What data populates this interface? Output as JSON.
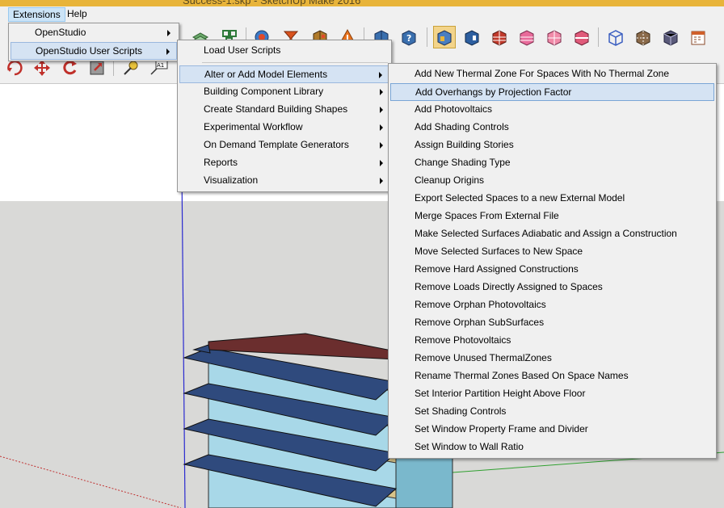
{
  "window": {
    "title": "Success-1.skp - SketchUp Make 2016"
  },
  "menubar": {
    "items": [
      {
        "label": "Extensions"
      },
      {
        "label": "Help"
      }
    ]
  },
  "extensions_menu": {
    "items": [
      {
        "label": "OpenStudio"
      },
      {
        "label": "OpenStudio User Scripts"
      }
    ]
  },
  "user_scripts_menu": {
    "items": [
      {
        "label": "Load User Scripts"
      },
      {
        "label": "Alter or Add Model Elements"
      },
      {
        "label": "Building Component Library"
      },
      {
        "label": "Create Standard Building Shapes"
      },
      {
        "label": "Experimental Workflow"
      },
      {
        "label": "On Demand Template Generators"
      },
      {
        "label": "Reports"
      },
      {
        "label": "Visualization"
      }
    ]
  },
  "alter_menu": {
    "items": [
      {
        "label": "Add New Thermal Zone For Spaces With No Thermal Zone"
      },
      {
        "label": "Add Overhangs by Projection Factor"
      },
      {
        "label": "Add Photovoltaics"
      },
      {
        "label": "Add Shading Controls"
      },
      {
        "label": "Assign Building Stories"
      },
      {
        "label": "Change Shading Type"
      },
      {
        "label": "Cleanup Origins"
      },
      {
        "label": "Export Selected Spaces to a new External Model"
      },
      {
        "label": "Merge Spaces From External File"
      },
      {
        "label": "Make Selected Surfaces Adiabatic and Assign a Construction"
      },
      {
        "label": "Move Selected Surfaces to New Space"
      },
      {
        "label": "Remove Hard Assigned Constructions"
      },
      {
        "label": "Remove Loads Directly Assigned to Spaces"
      },
      {
        "label": "Remove Orphan Photovoltaics"
      },
      {
        "label": "Remove Orphan SubSurfaces"
      },
      {
        "label": "Remove Photovoltaics"
      },
      {
        "label": "Remove Unused ThermalZones"
      },
      {
        "label": "Rename Thermal Zones Based On Space Names"
      },
      {
        "label": "Set Interior Partition Height Above Floor"
      },
      {
        "label": "Set Shading Controls"
      },
      {
        "label": "Set Window Property Frame and Divider"
      },
      {
        "label": "Set Window to Wall Ratio"
      }
    ]
  },
  "toolbar": {
    "tape_label": "A1"
  },
  "colors": {
    "accent": "#cce4f7",
    "menu_bg": "#f0f0f0",
    "highlight": "#d5e3f3",
    "roof": "#6b2e2e",
    "slab": "#d8c48a",
    "shade": "#2f4a7d",
    "glass": "#a8d8e8"
  }
}
